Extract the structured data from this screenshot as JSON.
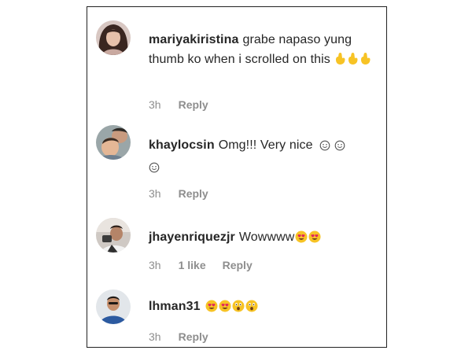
{
  "comments": [
    {
      "username": "mariyakiristina",
      "text": "grabe napaso yung thumb ko when i scrolled on this",
      "emojis": [
        "hand-icon",
        "hand-icon",
        "hand-icon"
      ],
      "time": "3h",
      "likes": "",
      "reply_label": "Reply"
    },
    {
      "username": "khaylocsin",
      "text": "Omg!!! Very nice",
      "emojis": [
        "smile-face-icon",
        "smile-face-icon",
        "smile-face-icon"
      ],
      "time": "3h",
      "likes": "",
      "reply_label": "Reply"
    },
    {
      "username": "jhayenriquezjr",
      "text": "Wowwww",
      "emojis": [
        "heart-eyes-icon",
        "heart-eyes-icon"
      ],
      "time": "3h",
      "likes": "1 like",
      "reply_label": "Reply"
    },
    {
      "username": "lhman31",
      "text": "",
      "emojis": [
        "heart-eyes-icon",
        "heart-eyes-icon",
        "astonished-face-icon",
        "astonished-face-icon"
      ],
      "time": "3h",
      "likes": "",
      "reply_label": "Reply"
    }
  ],
  "colors": {
    "text": "#262626",
    "meta": "#8e8e8e",
    "emoji_yellow": "#f7c325",
    "border": "#222222"
  }
}
